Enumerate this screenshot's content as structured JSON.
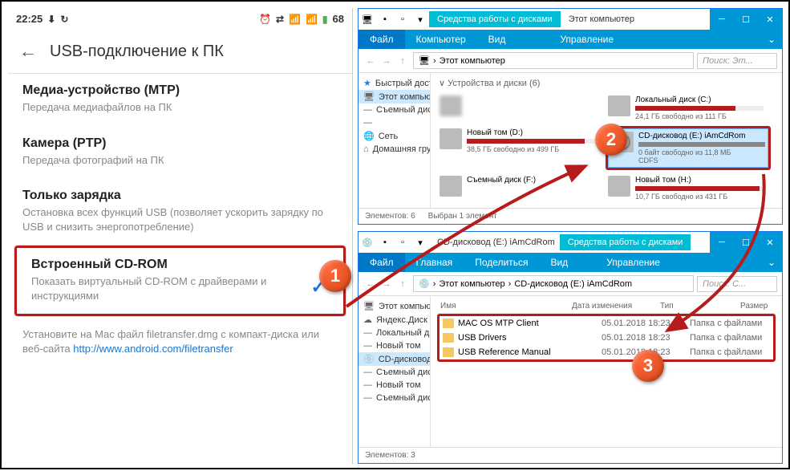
{
  "phone": {
    "status": {
      "time": "22:25",
      "battery": "68",
      "icons_left": [
        "⬇",
        "↻"
      ],
      "icons_right": [
        "⏰",
        "⇄",
        "📶",
        "📶",
        "🔋"
      ]
    },
    "header": {
      "title": "USB-подключение к ПК",
      "back_icon": "arrow-left"
    },
    "options": [
      {
        "title": "Медиа-устройство (MTP)",
        "desc": "Передача медиафайлов на ПК"
      },
      {
        "title": "Камера (PTP)",
        "desc": "Передача фотографий на ПК"
      },
      {
        "title": "Только зарядка",
        "desc": "Остановка всех функций USB (позволяет ускорить зарядку по USB и снизить энергопотребление)"
      },
      {
        "title": "Встроенный CD-ROM",
        "desc": "Показать виртуальный CD-ROM с драйверами и инструкциями",
        "selected": true
      }
    ],
    "hint_pre": "Установите на Mac файл filetransfer.dmg с компакт-диска или веб-сайта ",
    "hint_link": "http://www.android.com/filetransfer"
  },
  "explorer_top": {
    "tools_label": "Средства работы с дисками",
    "title": "Этот компьютер",
    "ribbon": {
      "file": "Файл",
      "tabs": [
        "Компьютер",
        "Вид"
      ],
      "context": "Управление"
    },
    "addr": {
      "path": "Этот компьютер",
      "search_placeholder": "Поиск: Эт..."
    },
    "sidebar": [
      {
        "icon": "★",
        "label": "Быстрый доступ",
        "color": "#2a7bde"
      },
      {
        "icon": "🖥",
        "label": "Этот компьютер",
        "sel": true
      },
      {
        "icon": "—",
        "label": "Съемный диск"
      },
      {
        "icon": "—",
        "label": ""
      },
      {
        "icon": "🌐",
        "label": "Сеть"
      },
      {
        "icon": "⌂",
        "label": "Домашняя группа"
      }
    ],
    "section": "Устройства и диски (6)",
    "drives": [
      {
        "name": "",
        "sub": "",
        "blur": true,
        "fill": 0,
        "color": "#26a0da"
      },
      {
        "name": "Локальный диск (C:)",
        "sub": "24,1 ГБ свободно из 111 ГБ",
        "fill": 78,
        "color": "#b71c1c"
      },
      {
        "name": "Новый том (D:)",
        "sub": "38,5 ГБ свободно из 499 ГБ",
        "fill": 92,
        "color": "#b71c1c"
      },
      {
        "name": "CD-дисковод (E:) iAmCdRom",
        "sub": "0 байт свободно из 11,8 МБ",
        "sub2": "CDFS",
        "fill": 100,
        "color": "#888",
        "sel": true,
        "cd": true
      },
      {
        "name": "Съемный диск (F:)",
        "sub": "",
        "fill": 0,
        "color": "#26a0da"
      },
      {
        "name": "Новый том (H:)",
        "sub": "10,7 ГБ свободно из 431 ГБ",
        "fill": 97,
        "color": "#b71c1c"
      }
    ],
    "statusbar": {
      "elements": "Элементов: 6",
      "selected": "Выбран 1 элемент"
    }
  },
  "explorer_bottom": {
    "tools_label": "Средства работы с дисками",
    "title": "CD-дисковод (E:) iAmCdRom",
    "ribbon": {
      "file": "Файл",
      "tabs": [
        "Главная",
        "Поделиться",
        "Вид"
      ],
      "context": "Управление"
    },
    "addr": {
      "crumb1": "Этот компьютер",
      "crumb2": "CD-дисковод (E:) iAmCdRom",
      "search_placeholder": "Поиск: C..."
    },
    "sidebar": [
      {
        "icon": "🖥",
        "label": "Этот компьютер"
      },
      {
        "icon": "☁",
        "label": "Яндекс.Диск"
      },
      {
        "icon": "—",
        "label": "Локальный диск"
      },
      {
        "icon": "—",
        "label": "Новый том"
      },
      {
        "icon": "💿",
        "label": "CD-дисковод",
        "sel": true
      },
      {
        "icon": "—",
        "label": "Съемный диск"
      },
      {
        "icon": "—",
        "label": "Новый том"
      },
      {
        "icon": "—",
        "label": "Съемный диск"
      }
    ],
    "columns": {
      "name": "Имя",
      "date": "Дата изменения",
      "type": "Тип",
      "size": "Размер"
    },
    "files": [
      {
        "name": "MAC OS MTP Client",
        "date": "05.01.2018 18:23",
        "type": "Папка с файлами"
      },
      {
        "name": "USB Drivers",
        "date": "05.01.2018 18:23",
        "type": "Папка с файлами"
      },
      {
        "name": "USB Reference Manual",
        "date": "05.01.2018 18:23",
        "type": "Папка с файлами"
      }
    ],
    "statusbar": {
      "elements": "Элементов: 3"
    }
  },
  "markers": {
    "1": "1",
    "2": "2",
    "3": "3"
  }
}
